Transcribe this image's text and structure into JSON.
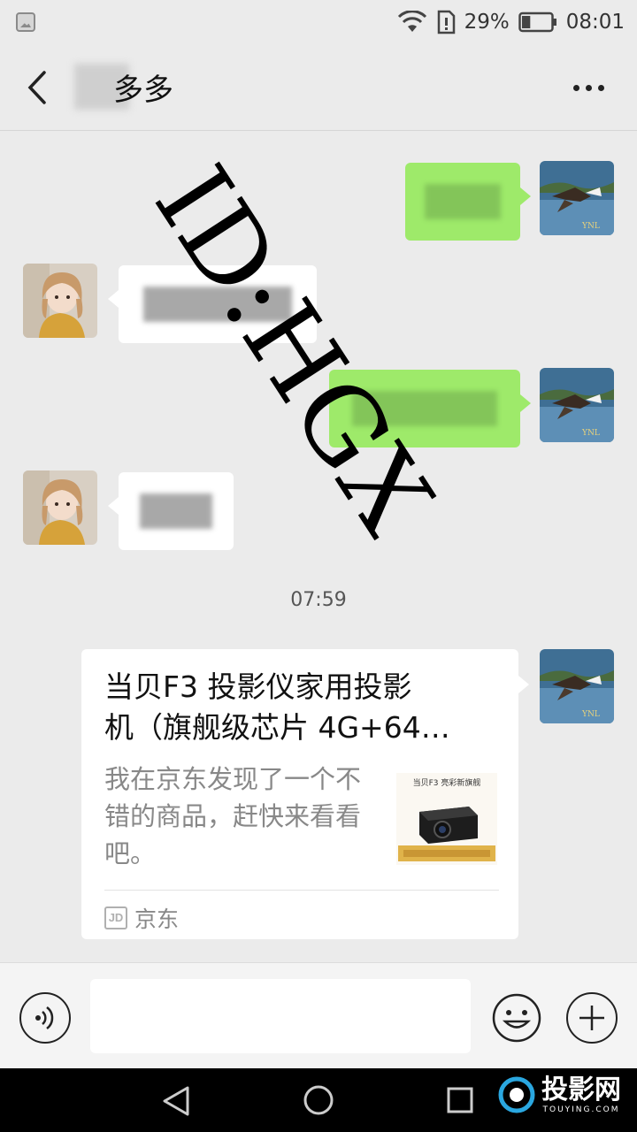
{
  "status_bar": {
    "battery_percent": "29%",
    "time": "08:01",
    "battery_level": 0.29
  },
  "header": {
    "title": "多多"
  },
  "messages": [
    {
      "direction": "out",
      "content": "redacted"
    },
    {
      "direction": "in",
      "content": "redacted"
    },
    {
      "direction": "out",
      "content": "redacted"
    },
    {
      "direction": "in",
      "content": "redacted"
    }
  ],
  "timestamp": "07:59",
  "link_card": {
    "title_line1": "当贝F3 投影仪家用投影",
    "title_line2": "机（旗舰级芯片 4G+64…",
    "description": "我在京东发现了一个不错的商品，赶快来看看吧。",
    "thumb_text": "当贝F3 亮彩新旗舰",
    "source_label": "京东",
    "source_logo": "JD"
  },
  "watermark": {
    "text": "ID:HGX"
  },
  "nav_watermark": {
    "text": "投影网",
    "subtext": "TOUYING.COM"
  },
  "icons": {
    "wifi": "wifi-icon",
    "sim": "sim-alert-icon",
    "battery": "battery-icon",
    "back": "back-arrow-icon",
    "more": "more-icon",
    "voice": "voice-icon",
    "emoji": "emoji-icon",
    "plus": "plus-icon"
  },
  "colors": {
    "outgoing_bubble": "#9eea6a",
    "incoming_bubble": "#ffffff",
    "background": "#ebebeb"
  }
}
